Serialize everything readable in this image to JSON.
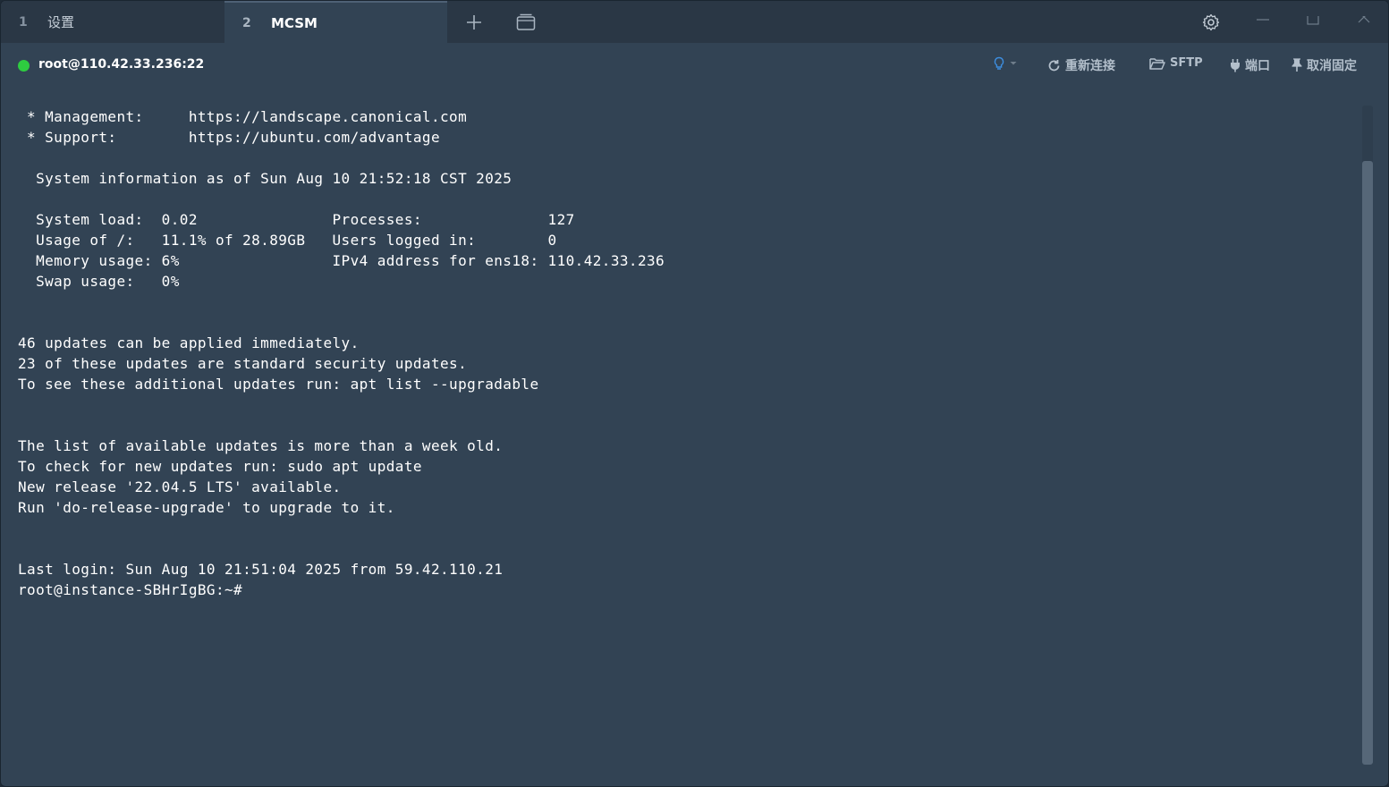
{
  "tabs": [
    {
      "number": "1",
      "label": "设置"
    },
    {
      "number": "2",
      "label": "MCSM"
    }
  ],
  "titlebar_icons": [
    "plus-icon",
    "window-icon",
    "gear-icon",
    "minimize-icon",
    "maximize-icon",
    "close-icon"
  ],
  "connection": {
    "title": "root@110.42.33.236:22",
    "status_color": "#2ecc40",
    "actions": {
      "reconnect": "重新连接",
      "sftp": "SFTP",
      "port": "端口",
      "unpin": "取消固定"
    }
  },
  "terminal_lines": [
    " * Management:     https://landscape.canonical.com",
    " * Support:        https://ubuntu.com/advantage",
    "",
    "  System information as of Sun Aug 10 21:52:18 CST 2025",
    "",
    "  System load:  0.02               Processes:              127",
    "  Usage of /:   11.1% of 28.89GB   Users logged in:        0",
    "  Memory usage: 6%                 IPv4 address for ens18: 110.42.33.236",
    "  Swap usage:   0%",
    "",
    "",
    "46 updates can be applied immediately.",
    "23 of these updates are standard security updates.",
    "To see these additional updates run: apt list --upgradable",
    "",
    "",
    "The list of available updates is more than a week old.",
    "To check for new updates run: sudo apt update",
    "New release '22.04.5 LTS' available.",
    "Run 'do-release-upgrade' to upgrade to it.",
    "",
    "",
    "Last login: Sun Aug 10 21:51:04 2025 from 59.42.110.21",
    "root@instance-SBHrIgBG:~#"
  ]
}
